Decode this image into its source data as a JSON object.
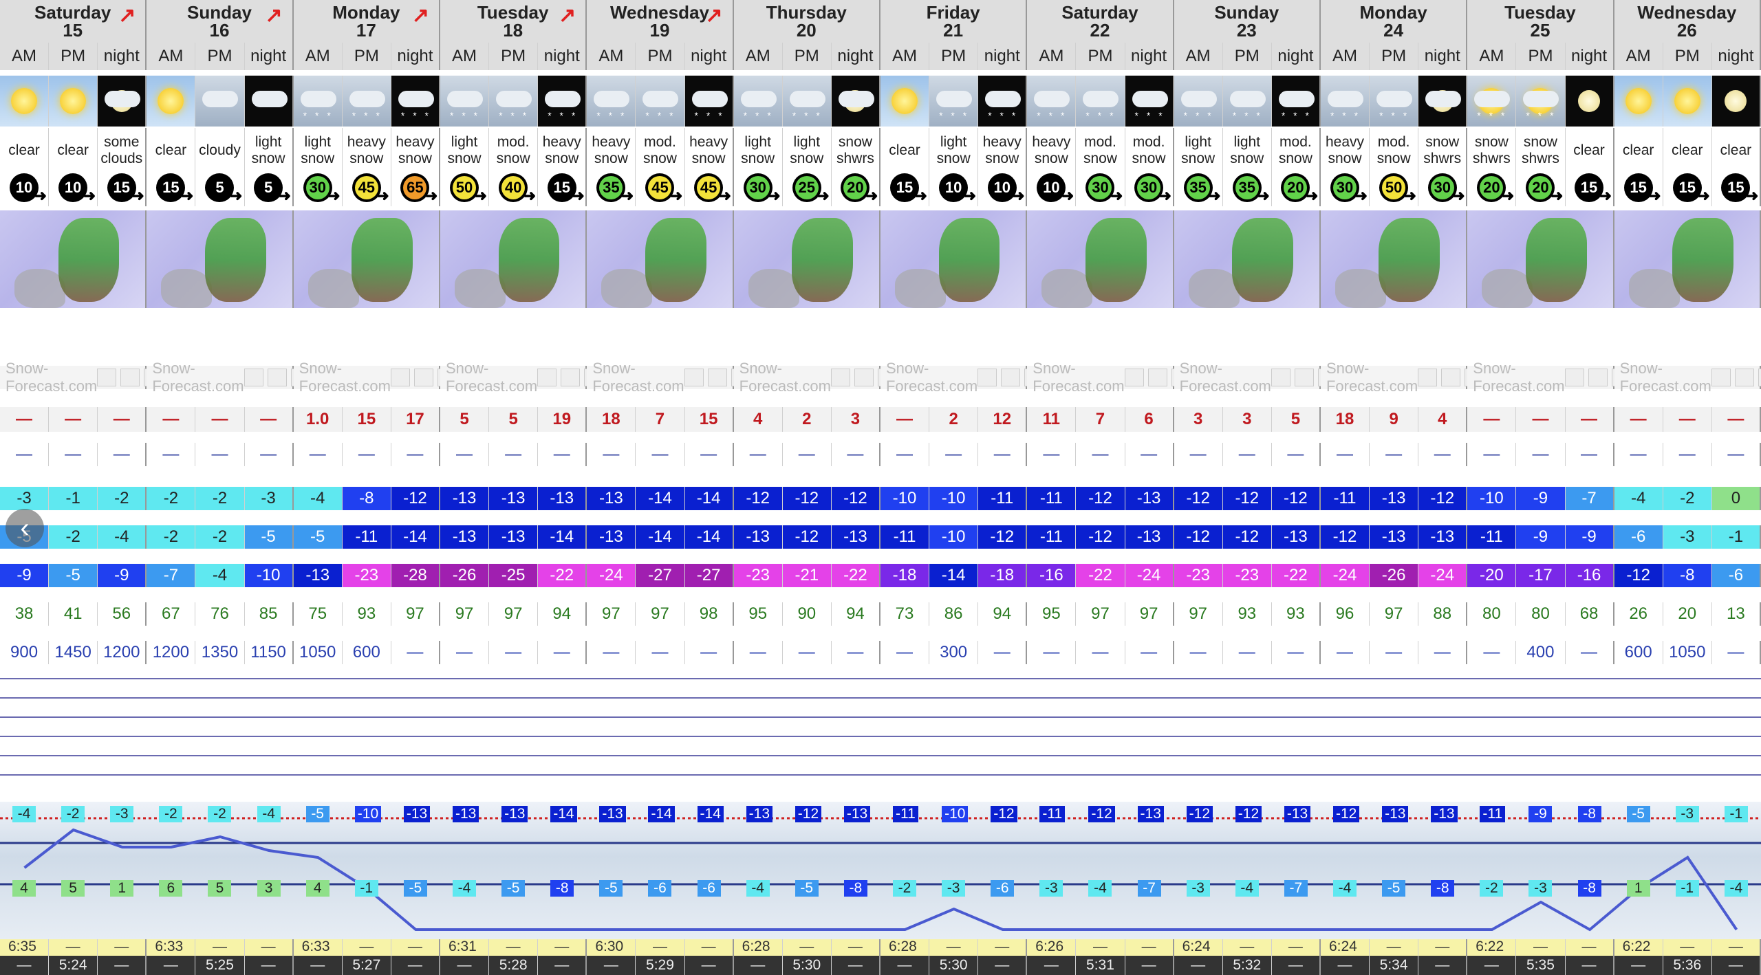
{
  "days": [
    {
      "name": "Saturday",
      "num": "15",
      "arrow": "↗"
    },
    {
      "name": "Sunday",
      "num": "16",
      "arrow": "↗"
    },
    {
      "name": "Monday",
      "num": "17",
      "arrow": "↗"
    },
    {
      "name": "Tuesday",
      "num": "18",
      "arrow": "↗"
    },
    {
      "name": "Wednesday",
      "num": "19",
      "arrow": "↗"
    },
    {
      "name": "Thursday",
      "num": "20",
      "arrow": ""
    },
    {
      "name": "Friday",
      "num": "21",
      "arrow": ""
    },
    {
      "name": "Saturday",
      "num": "22",
      "arrow": ""
    },
    {
      "name": "Sunday",
      "num": "23",
      "arrow": ""
    },
    {
      "name": "Monday",
      "num": "24",
      "arrow": ""
    },
    {
      "name": "Tuesday",
      "num": "25",
      "arrow": ""
    },
    {
      "name": "Wednesday",
      "num": "26",
      "arrow": ""
    }
  ],
  "periods": [
    "AM",
    "PM",
    "night"
  ],
  "brand": "Snow-Forecast.com",
  "icons": [
    "sun",
    "sun",
    "cloud-moon",
    "sun",
    "cloud",
    "cloud-night",
    "snow",
    "snow",
    "snow-night",
    "snow",
    "snow",
    "snow-night",
    "snow",
    "snow",
    "snow-night",
    "snow",
    "snow",
    "cloud-moon",
    "sun",
    "snow",
    "snow-night",
    "snow",
    "snow",
    "snow-night",
    "snow",
    "snow",
    "snow-night",
    "snow",
    "snow",
    "cloud-moon",
    "snow-sun",
    "snow-sun",
    "moon",
    "sun",
    "sun",
    "moon"
  ],
  "weather": [
    "clear",
    "clear",
    "some clouds",
    "clear",
    "cloudy",
    "light snow",
    "light snow",
    "heavy snow",
    "heavy snow",
    "light snow",
    "mod. snow",
    "heavy snow",
    "heavy snow",
    "mod. snow",
    "heavy snow",
    "light snow",
    "light snow",
    "snow shwrs",
    "clear",
    "light snow",
    "heavy snow",
    "heavy snow",
    "mod. snow",
    "mod. snow",
    "light snow",
    "light snow",
    "mod. snow",
    "heavy snow",
    "mod. snow",
    "snow shwrs",
    "snow shwrs",
    "snow shwrs",
    "clear",
    "clear",
    "clear",
    "clear"
  ],
  "wind": [
    "10",
    "10",
    "15",
    "15",
    "5",
    "5",
    "30",
    "45",
    "65",
    "50",
    "40",
    "15",
    "35",
    "45",
    "45",
    "30",
    "25",
    "20",
    "15",
    "10",
    "10",
    "10",
    "30",
    "30",
    "35",
    "35",
    "20",
    "30",
    "50",
    "30",
    "20",
    "20",
    "15",
    "15",
    "15",
    "15"
  ],
  "snow": [
    "—",
    "—",
    "—",
    "—",
    "—",
    "—",
    "1.0",
    "15",
    "17",
    "5",
    "5",
    "19",
    "18",
    "7",
    "15",
    "4",
    "2",
    "3",
    "—",
    "2",
    "12",
    "11",
    "7",
    "6",
    "3",
    "3",
    "5",
    "18",
    "9",
    "4",
    "—",
    "—",
    "—",
    "—",
    "—",
    "—"
  ],
  "rain": [
    "—",
    "—",
    "—",
    "—",
    "—",
    "—",
    "—",
    "—",
    "—",
    "—",
    "—",
    "—",
    "—",
    "—",
    "—",
    "—",
    "—",
    "—",
    "—",
    "—",
    "—",
    "—",
    "—",
    "—",
    "—",
    "—",
    "—",
    "—",
    "—",
    "—",
    "—",
    "—",
    "—",
    "—",
    "—",
    "—"
  ],
  "tmax": [
    "-3",
    "-1",
    "-2",
    "-2",
    "-2",
    "-3",
    "-4",
    "-8",
    "-12",
    "-13",
    "-13",
    "-13",
    "-13",
    "-14",
    "-14",
    "-12",
    "-12",
    "-12",
    "-10",
    "-10",
    "-11",
    "-11",
    "-12",
    "-13",
    "-12",
    "-12",
    "-12",
    "-11",
    "-13",
    "-12",
    "-10",
    "-9",
    "-7",
    "-4",
    "-2",
    "0"
  ],
  "tmin": [
    "-5",
    "-2",
    "-4",
    "-2",
    "-2",
    "-5",
    "-5",
    "-11",
    "-14",
    "-13",
    "-13",
    "-14",
    "-13",
    "-14",
    "-14",
    "-13",
    "-12",
    "-13",
    "-11",
    "-10",
    "-12",
    "-11",
    "-12",
    "-13",
    "-12",
    "-12",
    "-13",
    "-12",
    "-13",
    "-13",
    "-11",
    "-9",
    "-9",
    "-6",
    "-3",
    "-1"
  ],
  "chill": [
    "-9",
    "-5",
    "-9",
    "-7",
    "-4",
    "-10",
    "-13",
    "-23",
    "-28",
    "-26",
    "-25",
    "-22",
    "-24",
    "-27",
    "-27",
    "-23",
    "-21",
    "-22",
    "-18",
    "-14",
    "-18",
    "-16",
    "-22",
    "-24",
    "-23",
    "-23",
    "-22",
    "-24",
    "-26",
    "-24",
    "-20",
    "-17",
    "-16",
    "-12",
    "-8",
    "-6"
  ],
  "humidity": [
    "38",
    "41",
    "56",
    "67",
    "76",
    "85",
    "75",
    "93",
    "97",
    "97",
    "97",
    "94",
    "97",
    "97",
    "98",
    "95",
    "90",
    "94",
    "73",
    "86",
    "94",
    "95",
    "97",
    "97",
    "97",
    "93",
    "93",
    "96",
    "97",
    "88",
    "80",
    "80",
    "68",
    "26",
    "20",
    "13"
  ],
  "freezing": [
    "900",
    "1450",
    "1200",
    "1200",
    "1350",
    "1150",
    "1050",
    "600",
    "—",
    "—",
    "—",
    "—",
    "—",
    "—",
    "—",
    "—",
    "—",
    "—",
    "—",
    "300",
    "—",
    "—",
    "—",
    "—",
    "—",
    "—",
    "—",
    "—",
    "—",
    "—",
    "—",
    "400",
    "—",
    "600",
    "1050",
    "—"
  ],
  "summit": [
    "-4",
    "-2",
    "-3",
    "-2",
    "-2",
    "-4",
    "-5",
    "-10",
    "-13",
    "-13",
    "-13",
    "-14",
    "-13",
    "-14",
    "-14",
    "-13",
    "-12",
    "-13",
    "-11",
    "-10",
    "-12",
    "-11",
    "-12",
    "-13",
    "-12",
    "-12",
    "-13",
    "-12",
    "-13",
    "-13",
    "-11",
    "-9",
    "-8",
    "-5",
    "-3",
    "-1"
  ],
  "base": [
    "4",
    "5",
    "1",
    "6",
    "5",
    "3",
    "4",
    "-1",
    "-5",
    "-4",
    "-5",
    "-8",
    "-5",
    "-6",
    "-6",
    "-4",
    "-5",
    "-8",
    "-2",
    "-3",
    "-6",
    "-3",
    "-4",
    "-7",
    "-3",
    "-4",
    "-7",
    "-4",
    "-5",
    "-8",
    "-2",
    "-3",
    "-8",
    "1",
    "-1",
    "-4"
  ],
  "sunrise": [
    "6:35",
    "6:33",
    "6:33",
    "6:31",
    "6:30",
    "6:28",
    "6:28",
    "6:26",
    "6:24",
    "6:24",
    "6:22",
    "6:22"
  ],
  "sunset": [
    "5:24",
    "5:25",
    "5:27",
    "5:28",
    "5:29",
    "5:30",
    "5:30",
    "5:31",
    "5:32",
    "5:34",
    "5:35",
    "5:36"
  ],
  "dash": "—",
  "nav_icon": "‹"
}
